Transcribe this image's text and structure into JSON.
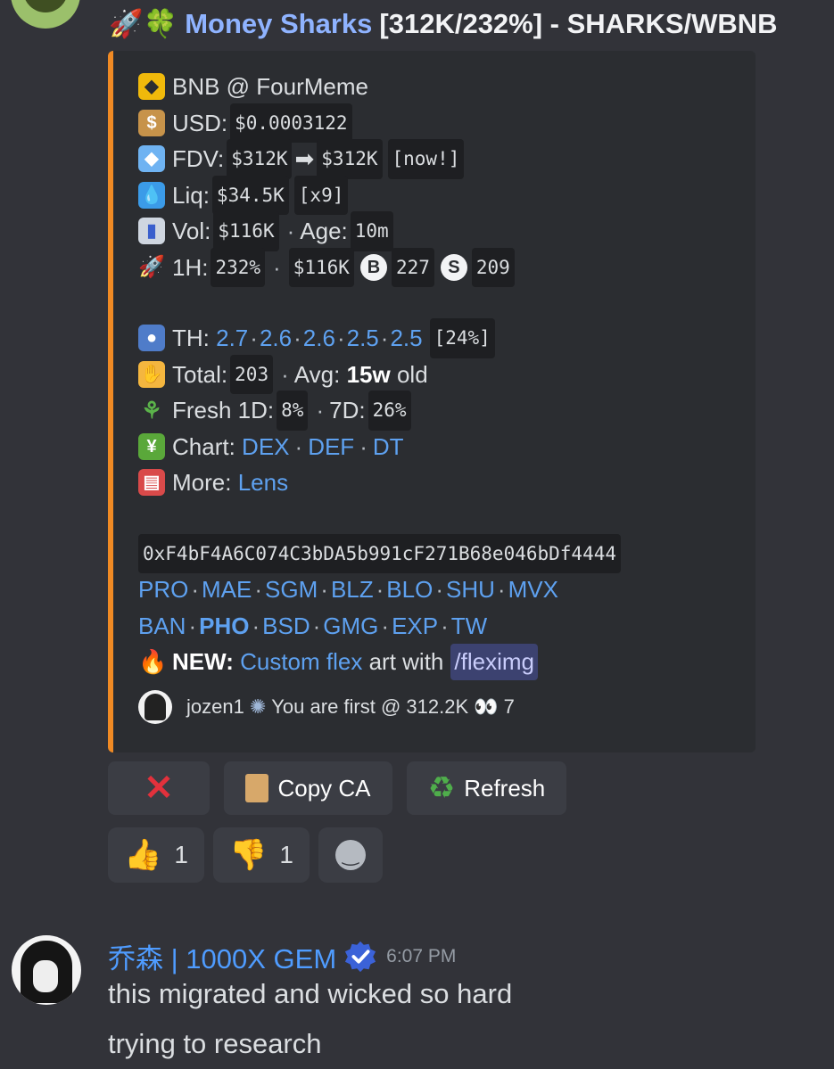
{
  "bot": {
    "title_emojis": "🚀🍀",
    "name": "Money Sharks",
    "title_rest": "[312K/232%] - SHARKS/WBNB"
  },
  "embed": {
    "chain": "BNB @ FourMeme",
    "usd_label": "USD:",
    "usd_value": "$0.0003122",
    "fdv_label": "FDV:",
    "fdv_from": "$312K",
    "fdv_arrow": "➡",
    "fdv_to": "$312K",
    "fdv_tag": "[now!]",
    "liq_label": "Liq:",
    "liq_value": "$34.5K",
    "liq_mult": "[x9]",
    "vol_label": "Vol:",
    "vol_value": "$116K",
    "age_label": "Age:",
    "age_value": "10m",
    "h1_label": "1H:",
    "h1_pct": "232%",
    "h1_vol": "$116K",
    "h1_buy_icon": "B",
    "h1_buys": "227",
    "h1_sell_icon": "S",
    "h1_sells": "209",
    "th_label": "TH:",
    "th_values": [
      "2.7",
      "2.6",
      "2.6",
      "2.5",
      "2.5"
    ],
    "th_pct": "[24%]",
    "total_label": "Total:",
    "total_value": "203",
    "avg_label": "Avg:",
    "avg_value": "15w",
    "avg_suffix": "old",
    "fresh_label": "Fresh 1D:",
    "fresh_1d": "8%",
    "fresh_7d_label": "7D:",
    "fresh_7d": "26%",
    "chart_label": "Chart:",
    "chart_links": [
      "DEX",
      "DEF",
      "DT"
    ],
    "more_label": "More:",
    "more_link": "Lens",
    "contract": "0xF4bF4A6C074C3bDA5b991cF271B68e046bDf4444",
    "links_row1": [
      "PRO",
      "MAE",
      "SGM",
      "BLZ",
      "BLO",
      "SHU",
      "MVX"
    ],
    "links_row2_first": "BAN",
    "links_row2_bold": "PHO",
    "links_row2": [
      "BSD",
      "GMG",
      "EXP",
      "TW"
    ],
    "new_label": "NEW:",
    "new_link": "Custom flex",
    "new_text": "art with",
    "new_cmd": "/fleximg",
    "footer_user": "jozen1",
    "footer_text": "You are first @ 312.2K",
    "footer_count": "7"
  },
  "buttons": {
    "close_icon": "✕",
    "copy_label": "Copy CA",
    "refresh_label": "Refresh"
  },
  "reactions": {
    "up_count": "1",
    "down_count": "1"
  },
  "message": {
    "author": "乔森 | 1000X GEM",
    "time": "6:07 PM",
    "lines": [
      "this migrated and wicked so hard",
      "trying to research"
    ]
  },
  "colors": {
    "accent_bar": "#f08a24",
    "link": "#5ea1f0",
    "author": "#4f9cff"
  }
}
